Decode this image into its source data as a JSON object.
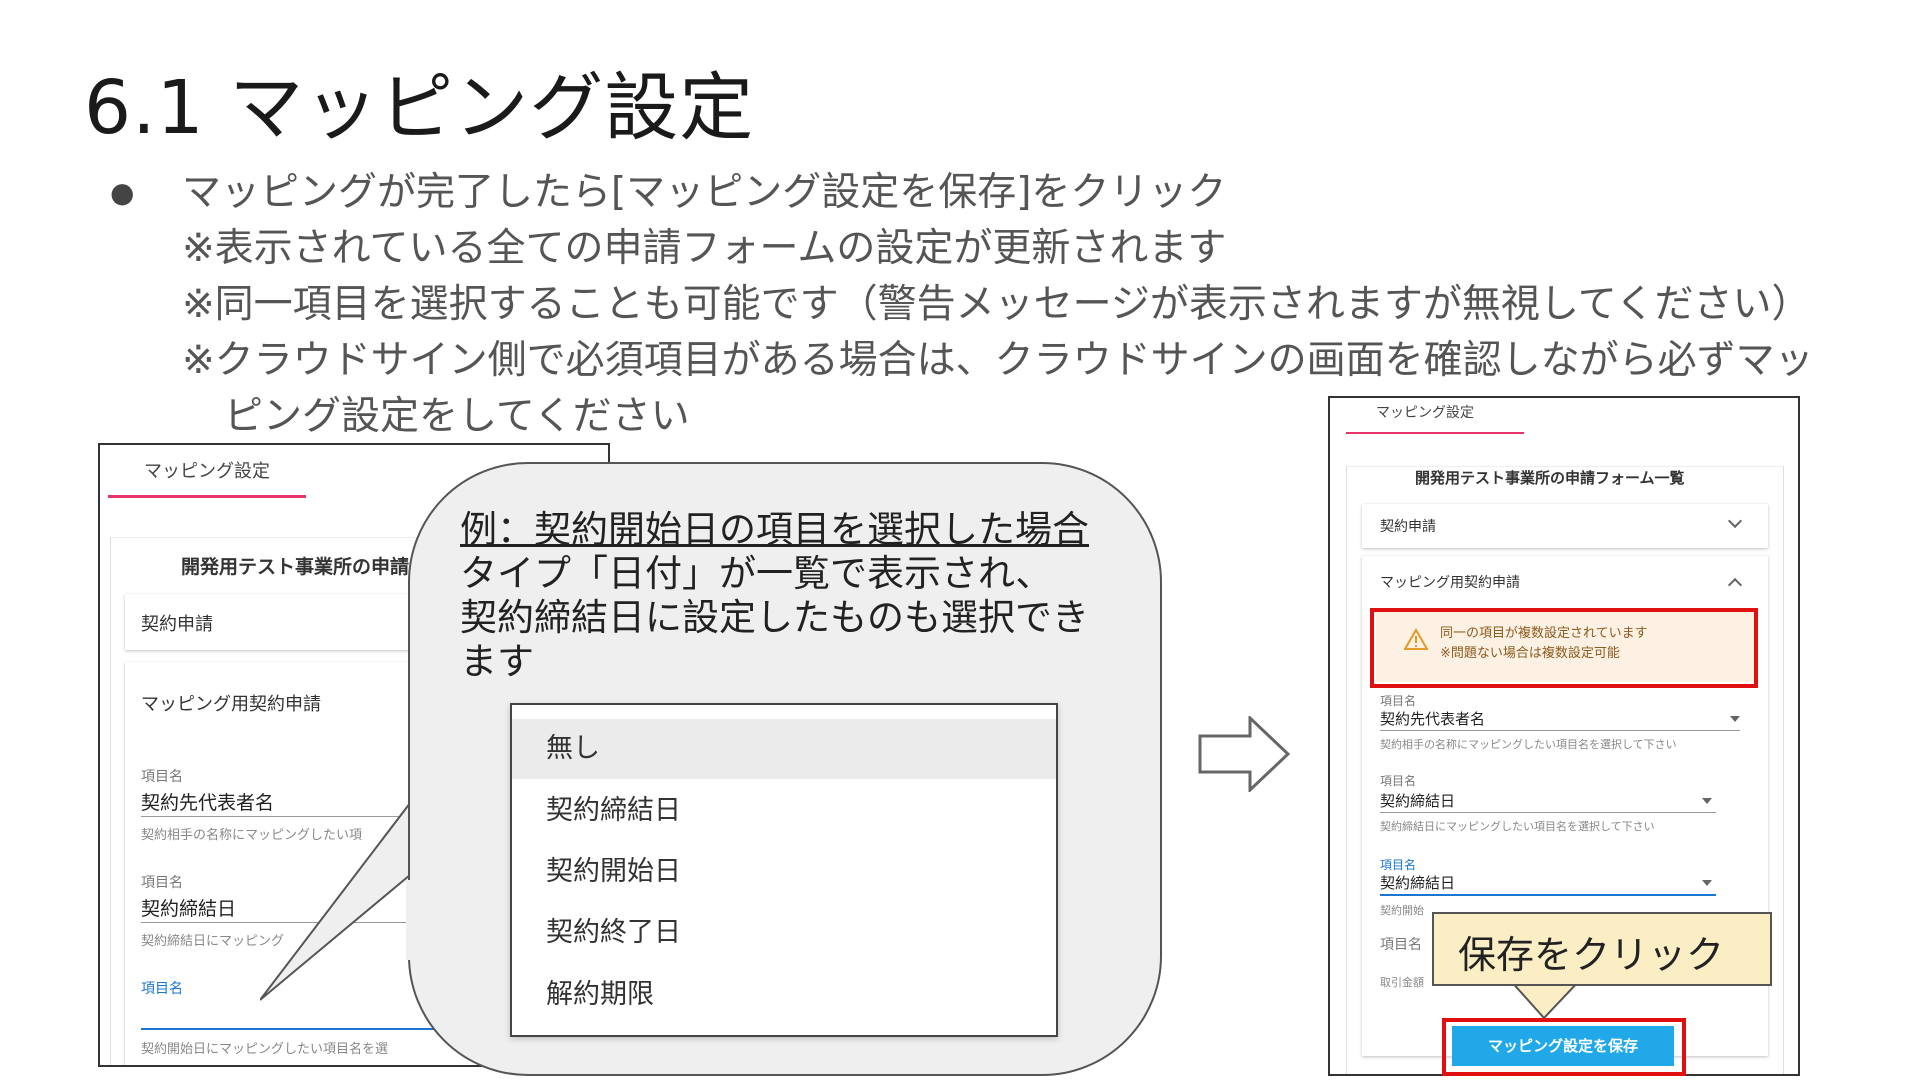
{
  "slide": {
    "title": "6.1 マッピング設定",
    "bullet_mark": "●",
    "bullet_lines": [
      "マッピングが完了したら[マッピング設定を保存]をクリック",
      "※表示されている全ての申請フォームの設定が更新されます",
      "※同一項目を選択することも可能です（警告メッセージが表示されますが無視してください）",
      "※クラウドサイン側で必須項目がある場合は、クラウドサインの画面を確認しながら必ずマッ",
      "ピング設定をしてください"
    ]
  },
  "left_panel": {
    "tab_label": "マッピング設定",
    "list_title": "開発用テスト事業所の申請",
    "card1_label": "契約申請",
    "card2_label": "マッピング用契約申請",
    "fields": [
      {
        "label": "項目名",
        "value": "契約先代表者名",
        "help": "契約相手の名称にマッピングしたい項"
      },
      {
        "label": "項目名",
        "value": "契約締結日",
        "help": "契約締結日にマッピング"
      },
      {
        "label": "項目名",
        "value": "",
        "help": "契約開始日にマッピングしたい項目名を選"
      }
    ]
  },
  "callout": {
    "headline": "例：契約開始日の項目を選択した場合",
    "lines": [
      "タイプ「日付」が一覧で表示され、",
      "契約締結日に設定したものも選択でき",
      "ます"
    ],
    "dropdown_options": [
      "無し",
      "契約締結日",
      "契約開始日",
      "契約終了日",
      "解約期限"
    ],
    "selected_index": 0
  },
  "right_panel": {
    "tab_label": "マッピング設定",
    "list_title": "開発用テスト事業所の申請フォーム一覧",
    "card1_label": "契約申請",
    "card2_label": "マッピング用契約申請",
    "warning_line1": "同一の項目が複数設定されています",
    "warning_line2": "※問題ない場合は複数設定可能",
    "fields": [
      {
        "label": "項目名",
        "value": "契約先代表者名",
        "help": "契約相手の名称にマッピングしたい項目名を選択して下さい"
      },
      {
        "label": "項目名",
        "value": "契約締結日",
        "help": "契約締結日にマッピングしたい項目名を選択して下さい"
      },
      {
        "label": "項目名",
        "value": "契約締結日",
        "help": "契約開始"
      },
      {
        "label": "項目名",
        "value": "",
        "help": "取引金額"
      }
    ],
    "save_callout": "保存をクリック",
    "save_button": "マッピング設定を保存"
  },
  "colors": {
    "tab_accent": "#e8336b",
    "highlight_red": "#e01010",
    "save_button": "#21a8e8",
    "warning_bg": "#fdf1e3",
    "callout_bg": "#fbeec4"
  }
}
